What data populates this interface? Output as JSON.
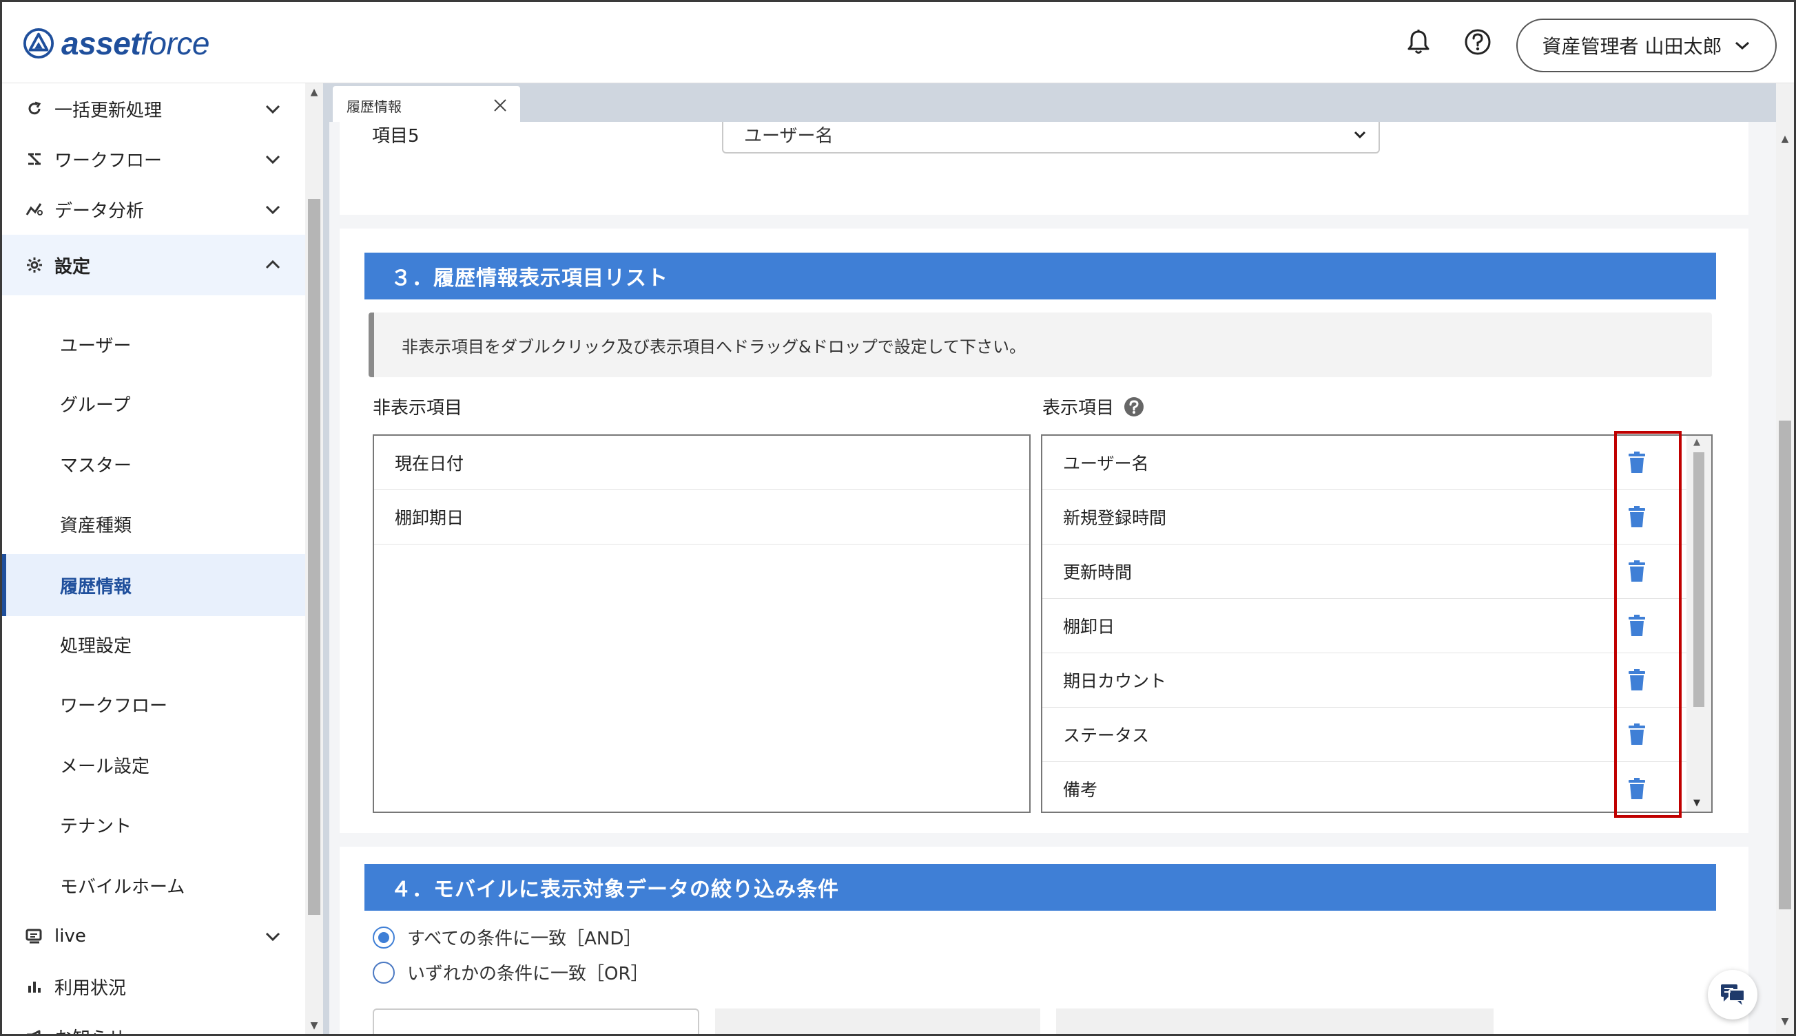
{
  "app": {
    "logo_text_bold": "asset",
    "logo_text_light": "force",
    "user_menu_label": "資産管理者 山田太郎"
  },
  "sidebar": {
    "items": [
      {
        "label": "一括更新処理",
        "icon": "refresh-icon",
        "expanded": false
      },
      {
        "label": "ワークフロー",
        "icon": "workflow-icon",
        "expanded": false
      },
      {
        "label": "データ分析",
        "icon": "analytics-icon",
        "expanded": false
      },
      {
        "label": "設定",
        "icon": "gear-icon",
        "expanded": true
      },
      {
        "label": "live",
        "icon": "live-icon",
        "expanded": false
      },
      {
        "label": "利用状況",
        "icon": "bar-chart-icon"
      },
      {
        "label": "お知らせ",
        "icon": "megaphone-icon"
      }
    ],
    "settings_children": [
      {
        "label": "ユーザー"
      },
      {
        "label": "グループ"
      },
      {
        "label": "マスター"
      },
      {
        "label": "資産種類"
      },
      {
        "label": "履歴情報",
        "selected": true
      },
      {
        "label": "処理設定"
      },
      {
        "label": "ワークフロー"
      },
      {
        "label": "メール設定"
      },
      {
        "label": "テナント"
      },
      {
        "label": "モバイルホーム"
      }
    ]
  },
  "tab": {
    "label": "履歴情報"
  },
  "item5": {
    "label": "項目5",
    "value": "ユーザー名"
  },
  "section3": {
    "title": "３．履歴情報表示項目リスト",
    "notice": "非表示項目をダブルクリック及び表示項目へドラッグ&ドロップで設定して下さい。",
    "hidden_title": "非表示項目",
    "shown_title": "表示項目",
    "hidden_items": [
      "現在日付",
      "棚卸期日"
    ],
    "shown_items": [
      "ユーザー名",
      "新規登録時間",
      "更新時間",
      "棚卸日",
      "期日カウント",
      "ステータス",
      "備考"
    ]
  },
  "section4": {
    "title": "４．モバイルに表示対象データの絞り込み条件",
    "options": [
      {
        "label": "すべての条件に一致［AND］",
        "checked": true
      },
      {
        "label": "いずれかの条件に一致［OR］",
        "checked": false
      }
    ]
  },
  "colors": {
    "accent": "#3f7fd6",
    "brand": "#1f4f9c",
    "highlight": "#c00000"
  }
}
